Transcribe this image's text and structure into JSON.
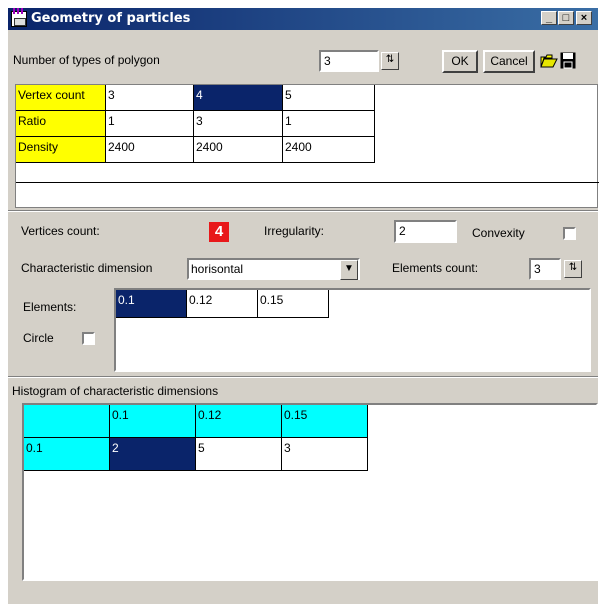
{
  "window": {
    "title": "Geometry of particles",
    "minimize": "_",
    "maximize": "□",
    "close": "×"
  },
  "top": {
    "types_label": "Number of types of polygon",
    "types_value": "3",
    "ok_label": "OK",
    "cancel_label": "Cancel",
    "open_icon": "folder-open-icon",
    "save_icon": "floppy-disk-icon"
  },
  "polygon_table": {
    "rows": [
      {
        "label": "Vertex count",
        "values": [
          "3",
          "4",
          "5"
        ]
      },
      {
        "label": "Ratio",
        "values": [
          "1",
          "3",
          "1"
        ]
      },
      {
        "label": "Density",
        "values": [
          "2400",
          "2400",
          "2400"
        ]
      }
    ],
    "selected": {
      "row": 0,
      "col": 1
    }
  },
  "details": {
    "vertices_label": "Vertices count:",
    "vertices_value": "4",
    "vertices_color": "#e8181a",
    "irregularity_label": "Irregularity:",
    "irregularity_value": "2",
    "convexity_label": "Convexity",
    "char_dim_label": "Characteristic dimension",
    "char_dim_value": "horisontal",
    "elements_count_label": "Elements count:",
    "elements_count_value": "3",
    "elements_label": "Elements:",
    "circle_label": "Circle",
    "elements": [
      "0.1",
      "0.12",
      "0.15"
    ]
  },
  "histogram": {
    "label": "Histogram of characteristic dimensions",
    "columns": [
      "",
      "0.1",
      "0.12",
      "0.15"
    ],
    "rows": [
      {
        "head": "0.1",
        "values": [
          "2",
          "5",
          "3"
        ]
      }
    ]
  },
  "colors": {
    "header_yellow": "#ffff00",
    "header_cyan": "#00ffff",
    "selection": "#0a246a",
    "face": "#d4d0c8"
  }
}
